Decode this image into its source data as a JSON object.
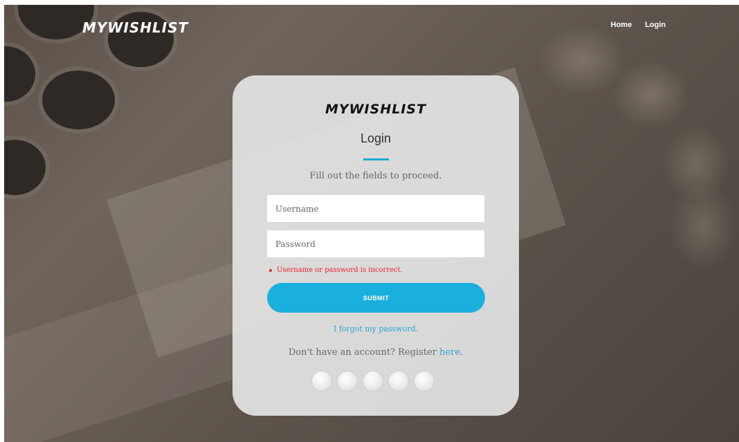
{
  "header": {
    "logo": "MYWISHLIST",
    "nav": [
      {
        "label": "Home"
      },
      {
        "label": "Login"
      }
    ]
  },
  "card": {
    "logo": "MYWISHLIST",
    "title": "Login",
    "subtitle": "Fill out the fields to proceed.",
    "username": {
      "placeholder": "Username",
      "value": ""
    },
    "password": {
      "placeholder": "Password",
      "value": ""
    },
    "error": "Username or password is incorrect.",
    "submit_label": "SUBMIT",
    "forgot_label": "I forgot my password.",
    "register_prefix": "Don't have an account? Register ",
    "register_link": "here",
    "register_suffix": "."
  },
  "colors": {
    "accent": "#1ab0dd",
    "error": "#e8202a"
  }
}
